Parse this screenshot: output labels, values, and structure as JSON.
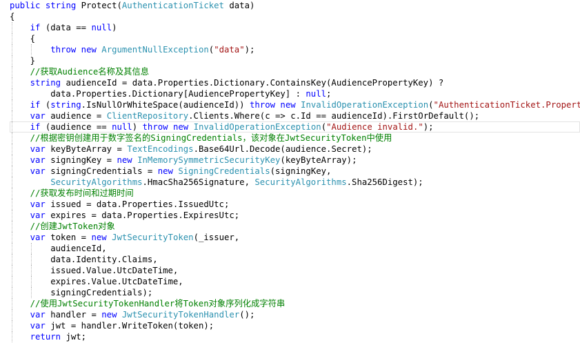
{
  "editor": {
    "lines": [
      [
        {
          "c": "kw",
          "t": "public"
        },
        {
          "c": "id",
          "t": " "
        },
        {
          "c": "kw",
          "t": "string"
        },
        {
          "c": "id",
          "t": " Protect("
        },
        {
          "c": "ty",
          "t": "AuthenticationTicket"
        },
        {
          "c": "id",
          "t": " data)"
        }
      ],
      [
        {
          "c": "id",
          "t": "{"
        }
      ],
      [
        {
          "c": "id",
          "t": "    "
        },
        {
          "c": "kw",
          "t": "if"
        },
        {
          "c": "id",
          "t": " (data == "
        },
        {
          "c": "kw",
          "t": "null"
        },
        {
          "c": "id",
          "t": ")"
        }
      ],
      [
        {
          "c": "id",
          "t": "    {"
        }
      ],
      [
        {
          "c": "id",
          "t": "        "
        },
        {
          "c": "kw",
          "t": "throw"
        },
        {
          "c": "id",
          "t": " "
        },
        {
          "c": "kw",
          "t": "new"
        },
        {
          "c": "id",
          "t": " "
        },
        {
          "c": "ty",
          "t": "ArgumentNullException"
        },
        {
          "c": "id",
          "t": "("
        },
        {
          "c": "str",
          "t": "\"data\""
        },
        {
          "c": "id",
          "t": ");"
        }
      ],
      [
        {
          "c": "id",
          "t": "    }"
        }
      ],
      [
        {
          "c": "id",
          "t": "    "
        },
        {
          "c": "cm",
          "t": "//获取Audience名称及其信息"
        }
      ],
      [
        {
          "c": "id",
          "t": "    "
        },
        {
          "c": "kw",
          "t": "string"
        },
        {
          "c": "id",
          "t": " audienceId = data.Properties.Dictionary.ContainsKey(AudiencePropertyKey) ?"
        }
      ],
      [
        {
          "c": "id",
          "t": "        data.Properties.Dictionary[AudiencePropertyKey] : "
        },
        {
          "c": "kw",
          "t": "null"
        },
        {
          "c": "id",
          "t": ";"
        }
      ],
      [
        {
          "c": "id",
          "t": "    "
        },
        {
          "c": "kw",
          "t": "if"
        },
        {
          "c": "id",
          "t": " ("
        },
        {
          "c": "kw",
          "t": "string"
        },
        {
          "c": "id",
          "t": ".IsNullOrWhiteSpace(audienceId)) "
        },
        {
          "c": "kw",
          "t": "throw"
        },
        {
          "c": "id",
          "t": " "
        },
        {
          "c": "kw",
          "t": "new"
        },
        {
          "c": "id",
          "t": " "
        },
        {
          "c": "ty",
          "t": "InvalidOperationException"
        },
        {
          "c": "id",
          "t": "("
        },
        {
          "c": "str",
          "t": "\"AuthenticationTicket.Properties doe"
        }
      ],
      [
        {
          "c": "id",
          "t": "    "
        },
        {
          "c": "kw",
          "t": "var"
        },
        {
          "c": "id",
          "t": " audience = "
        },
        {
          "c": "ty",
          "t": "ClientRepository"
        },
        {
          "c": "id",
          "t": ".Clients.Where(c => c.Id == audienceId).FirstOrDefault();"
        }
      ],
      [
        {
          "c": "id",
          "t": "    "
        },
        {
          "c": "kw",
          "t": "if"
        },
        {
          "c": "id",
          "t": " (audience == "
        },
        {
          "c": "kw",
          "t": "null"
        },
        {
          "c": "id",
          "t": ") "
        },
        {
          "c": "kw",
          "t": "throw"
        },
        {
          "c": "id",
          "t": " "
        },
        {
          "c": "kw",
          "t": "new"
        },
        {
          "c": "id",
          "t": " "
        },
        {
          "c": "ty",
          "t": "InvalidOperationException"
        },
        {
          "c": "id",
          "t": "("
        },
        {
          "c": "str",
          "t": "\"Audience invalid.\""
        },
        {
          "c": "id",
          "t": ");"
        }
      ],
      [
        {
          "c": "id",
          "t": "    "
        },
        {
          "c": "cm",
          "t": "//根据密钥创建用于数字签名的SigningCredentials，该对象在JwtSecurityToken中使用"
        }
      ],
      [
        {
          "c": "id",
          "t": "    "
        },
        {
          "c": "kw",
          "t": "var"
        },
        {
          "c": "id",
          "t": " keyByteArray = "
        },
        {
          "c": "ty",
          "t": "TextEncodings"
        },
        {
          "c": "id",
          "t": ".Base64Url.Decode(audience.Secret);"
        }
      ],
      [
        {
          "c": "id",
          "t": "    "
        },
        {
          "c": "kw",
          "t": "var"
        },
        {
          "c": "id",
          "t": " signingKey = "
        },
        {
          "c": "kw",
          "t": "new"
        },
        {
          "c": "id",
          "t": " "
        },
        {
          "c": "ty",
          "t": "InMemorySymmetricSecurityKey"
        },
        {
          "c": "id",
          "t": "(keyByteArray);"
        }
      ],
      [
        {
          "c": "id",
          "t": "    "
        },
        {
          "c": "kw",
          "t": "var"
        },
        {
          "c": "id",
          "t": " signingCredentials = "
        },
        {
          "c": "kw",
          "t": "new"
        },
        {
          "c": "id",
          "t": " "
        },
        {
          "c": "ty",
          "t": "SigningCredentials"
        },
        {
          "c": "id",
          "t": "(signingKey,"
        }
      ],
      [
        {
          "c": "id",
          "t": "        "
        },
        {
          "c": "ty",
          "t": "SecurityAlgorithms"
        },
        {
          "c": "id",
          "t": ".HmacSha256Signature, "
        },
        {
          "c": "ty",
          "t": "SecurityAlgorithms"
        },
        {
          "c": "id",
          "t": ".Sha256Digest);"
        }
      ],
      [
        {
          "c": "id",
          "t": "    "
        },
        {
          "c": "cm",
          "t": "//获取发布时间和过期时间"
        }
      ],
      [
        {
          "c": "id",
          "t": "    "
        },
        {
          "c": "kw",
          "t": "var"
        },
        {
          "c": "id",
          "t": " issued = data.Properties.IssuedUtc;"
        }
      ],
      [
        {
          "c": "id",
          "t": "    "
        },
        {
          "c": "kw",
          "t": "var"
        },
        {
          "c": "id",
          "t": " expires = data.Properties.ExpiresUtc;"
        }
      ],
      [
        {
          "c": "id",
          "t": "    "
        },
        {
          "c": "cm",
          "t": "//创建JwtToken对象"
        }
      ],
      [
        {
          "c": "id",
          "t": "    "
        },
        {
          "c": "kw",
          "t": "var"
        },
        {
          "c": "id",
          "t": " token = "
        },
        {
          "c": "kw",
          "t": "new"
        },
        {
          "c": "id",
          "t": " "
        },
        {
          "c": "ty",
          "t": "JwtSecurityToken"
        },
        {
          "c": "id",
          "t": "(_issuer,"
        }
      ],
      [
        {
          "c": "id",
          "t": "        audienceId,"
        }
      ],
      [
        {
          "c": "id",
          "t": "        data.Identity.Claims,"
        }
      ],
      [
        {
          "c": "id",
          "t": "        issued.Value.UtcDateTime,"
        }
      ],
      [
        {
          "c": "id",
          "t": "        expires.Value.UtcDateTime,"
        }
      ],
      [
        {
          "c": "id",
          "t": "        signingCredentials);"
        }
      ],
      [
        {
          "c": "id",
          "t": "    "
        },
        {
          "c": "cm",
          "t": "//使用JwtSecurityTokenHandler将Token对象序列化成字符串"
        }
      ],
      [
        {
          "c": "id",
          "t": "    "
        },
        {
          "c": "kw",
          "t": "var"
        },
        {
          "c": "id",
          "t": " handler = "
        },
        {
          "c": "kw",
          "t": "new"
        },
        {
          "c": "id",
          "t": " "
        },
        {
          "c": "ty",
          "t": "JwtSecurityTokenHandler"
        },
        {
          "c": "id",
          "t": "();"
        }
      ],
      [
        {
          "c": "id",
          "t": "    "
        },
        {
          "c": "kw",
          "t": "var"
        },
        {
          "c": "id",
          "t": " jwt = handler.WriteToken(token);"
        }
      ],
      [
        {
          "c": "id",
          "t": "    "
        },
        {
          "c": "kw",
          "t": "return"
        },
        {
          "c": "id",
          "t": " jwt;"
        }
      ]
    ],
    "colors": {
      "keyword": "#0000ff",
      "type": "#2b91af",
      "string": "#a31515",
      "comment": "#008000",
      "text": "#000000",
      "background": "#ffffff"
    }
  }
}
